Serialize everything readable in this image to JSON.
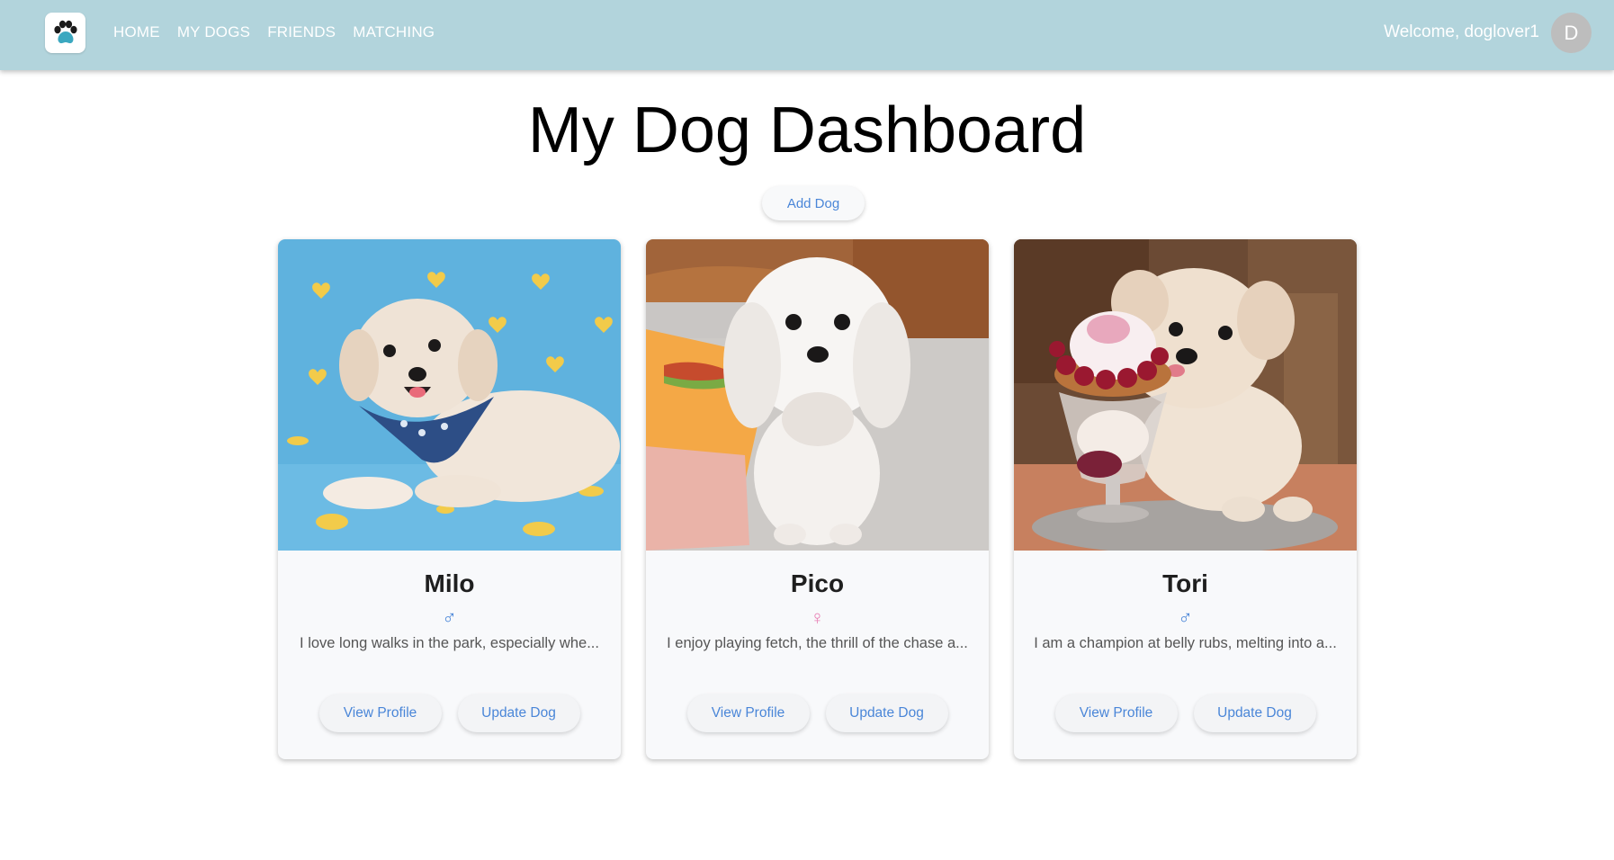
{
  "nav": {
    "logo_icon": "paw-icon",
    "links": [
      "HOME",
      "MY DOGS",
      "FRIENDS",
      "MATCHING"
    ],
    "welcome": "Welcome, doglover1",
    "avatar_initial": "D",
    "bar_color": "#b2d4dc"
  },
  "main": {
    "title": "My Dog Dashboard",
    "add_dog_label": "Add Dog"
  },
  "dogs": [
    {
      "name": "Milo",
      "gender_symbol": "♂",
      "gender": "male",
      "bio": "I love long walks in the park, especially whe...",
      "view_label": "View Profile",
      "update_label": "Update Dog"
    },
    {
      "name": "Pico",
      "gender_symbol": "♀",
      "gender": "female",
      "bio": "I enjoy playing fetch, the thrill of the chase a...",
      "view_label": "View Profile",
      "update_label": "Update Dog"
    },
    {
      "name": "Tori",
      "gender_symbol": "♂",
      "gender": "male",
      "bio": "I am a champion at belly rubs, melting into a...",
      "view_label": "View Profile",
      "update_label": "Update Dog"
    }
  ],
  "colors": {
    "accent": "#4a86d8",
    "male": "#4a86d8",
    "female": "#e87fb4"
  }
}
